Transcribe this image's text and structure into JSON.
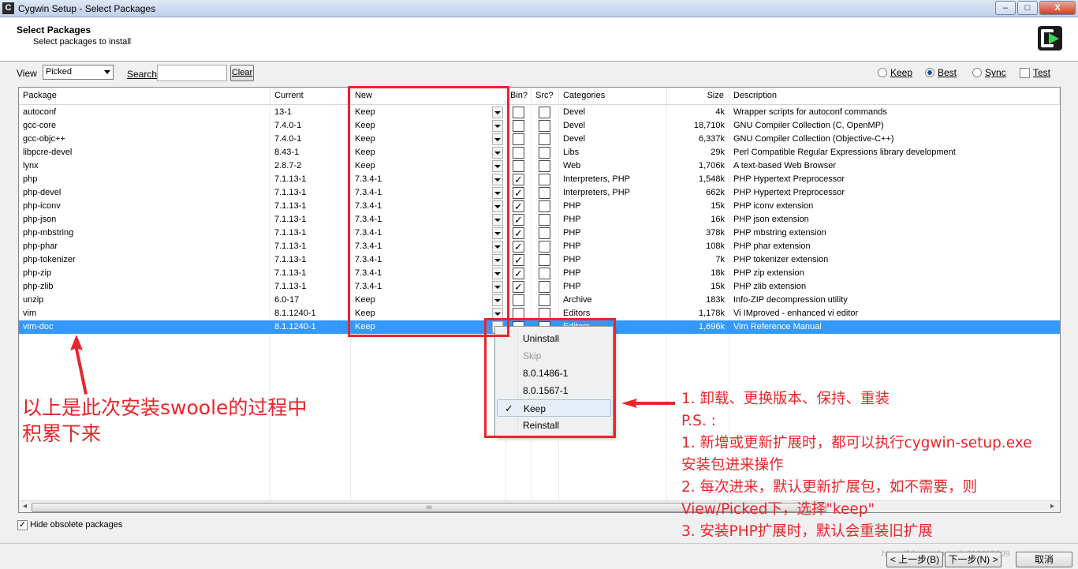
{
  "window": {
    "title": "Cygwin Setup - Select Packages",
    "controls": [
      "–",
      "□",
      "X"
    ]
  },
  "header": {
    "title": "Select Packages",
    "subtitle": "Select packages to install"
  },
  "toolbar": {
    "view_label": "View",
    "view_value": "Picked",
    "search_label": "Search",
    "search_value": "",
    "clear_label": "Clear",
    "keep_label": "Keep",
    "best_label": "Best",
    "sync_label": "Sync",
    "test_label": "Test",
    "selected_mode": "Best"
  },
  "columns": [
    "Package",
    "Current",
    "New",
    "Bin?",
    "Src?",
    "Categories",
    "Size",
    "Description"
  ],
  "rows": [
    {
      "package": "autoconf",
      "current": "13-1",
      "new": "Keep",
      "bin": false,
      "src": false,
      "categories": "Devel",
      "size": "4k",
      "description": "Wrapper scripts for autoconf commands"
    },
    {
      "package": "gcc-core",
      "current": "7.4.0-1",
      "new": "Keep",
      "bin": false,
      "src": false,
      "categories": "Devel",
      "size": "18,710k",
      "description": "GNU Compiler Collection (C, OpenMP)"
    },
    {
      "package": "gcc-objc++",
      "current": "7.4.0-1",
      "new": "Keep",
      "bin": false,
      "src": false,
      "categories": "Devel",
      "size": "6,337k",
      "description": "GNU Compiler Collection (Objective-C++)"
    },
    {
      "package": "libpcre-devel",
      "current": "8.43-1",
      "new": "Keep",
      "bin": false,
      "src": false,
      "categories": "Libs",
      "size": "29k",
      "description": "Perl Compatible Regular Expressions library development"
    },
    {
      "package": "lynx",
      "current": "2.8.7-2",
      "new": "Keep",
      "bin": false,
      "src": false,
      "categories": "Web",
      "size": "1,706k",
      "description": "A text-based Web Browser"
    },
    {
      "package": "php",
      "current": "7.1.13-1",
      "new": "7.3.4-1",
      "bin": true,
      "src": false,
      "categories": "Interpreters, PHP",
      "size": "1,548k",
      "description": "PHP Hypertext Preprocessor"
    },
    {
      "package": "php-devel",
      "current": "7.1.13-1",
      "new": "7.3.4-1",
      "bin": true,
      "src": false,
      "categories": "Interpreters, PHP",
      "size": "662k",
      "description": "PHP Hypertext Preprocessor"
    },
    {
      "package": "php-iconv",
      "current": "7.1.13-1",
      "new": "7.3.4-1",
      "bin": true,
      "src": false,
      "categories": "PHP",
      "size": "15k",
      "description": "PHP iconv extension"
    },
    {
      "package": "php-json",
      "current": "7.1.13-1",
      "new": "7.3.4-1",
      "bin": true,
      "src": false,
      "categories": "PHP",
      "size": "16k",
      "description": "PHP json extension"
    },
    {
      "package": "php-mbstring",
      "current": "7.1.13-1",
      "new": "7.3.4-1",
      "bin": true,
      "src": false,
      "categories": "PHP",
      "size": "378k",
      "description": "PHP mbstring extension"
    },
    {
      "package": "php-phar",
      "current": "7.1.13-1",
      "new": "7.3.4-1",
      "bin": true,
      "src": false,
      "categories": "PHP",
      "size": "108k",
      "description": "PHP phar extension"
    },
    {
      "package": "php-tokenizer",
      "current": "7.1.13-1",
      "new": "7.3.4-1",
      "bin": true,
      "src": false,
      "categories": "PHP",
      "size": "7k",
      "description": "PHP tokenizer extension"
    },
    {
      "package": "php-zip",
      "current": "7.1.13-1",
      "new": "7.3.4-1",
      "bin": true,
      "src": false,
      "categories": "PHP",
      "size": "18k",
      "description": "PHP zip extension"
    },
    {
      "package": "php-zlib",
      "current": "7.1.13-1",
      "new": "7.3.4-1",
      "bin": true,
      "src": false,
      "categories": "PHP",
      "size": "15k",
      "description": "PHP zlib extension"
    },
    {
      "package": "unzip",
      "current": "6.0-17",
      "new": "Keep",
      "bin": false,
      "src": false,
      "categories": "Archive",
      "size": "183k",
      "description": "Info-ZIP decompression utility"
    },
    {
      "package": "vim",
      "current": "8.1.1240-1",
      "new": "Keep",
      "bin": false,
      "src": false,
      "categories": "Editors",
      "size": "1,178k",
      "description": "Vi IMproved - enhanced vi editor"
    },
    {
      "package": "vim-doc",
      "current": "8.1.1240-1",
      "new": "Keep",
      "bin": false,
      "src": false,
      "categories": "Editors",
      "size": "1,696k",
      "description": "Vim Reference Manual",
      "selected": true
    }
  ],
  "popup": {
    "items": [
      {
        "label": "Uninstall",
        "disabled": false,
        "checked": false
      },
      {
        "label": "Skip",
        "disabled": true,
        "checked": false
      },
      {
        "label": "8.0.1486-1",
        "disabled": false,
        "checked": false
      },
      {
        "label": "8.0.1567-1",
        "disabled": false,
        "checked": false
      },
      {
        "label": "Keep",
        "disabled": false,
        "checked": true
      },
      {
        "label": "Reinstall",
        "disabled": false,
        "checked": false
      }
    ]
  },
  "footer": {
    "hide_obsolete_label": "Hide obsolete packages",
    "hide_obsolete_checked": true,
    "back_label": "< 上一步(B)",
    "next_label": "下一步(N) >",
    "cancel_label": "取消",
    "watermark": "https://blog.csdn.net/u010903009"
  },
  "annotations": {
    "left_text_line1": "以上是此次安装swoole的过程中",
    "left_text_line2": "积累下来",
    "right_lines": [
      "1. 卸载、更换版本、保持、重装",
      "P.S. :",
      "1. 新增或更新扩展时，都可以执行cygwin-setup.exe",
      "安装包进来操作",
      "2. 每次进来，默认更新扩展包，如不需要，则",
      "View/Picked下，选择\"keep\"",
      "3. 安装PHP扩展时，默认会重装旧扩展"
    ],
    "color": "#e8262a"
  }
}
